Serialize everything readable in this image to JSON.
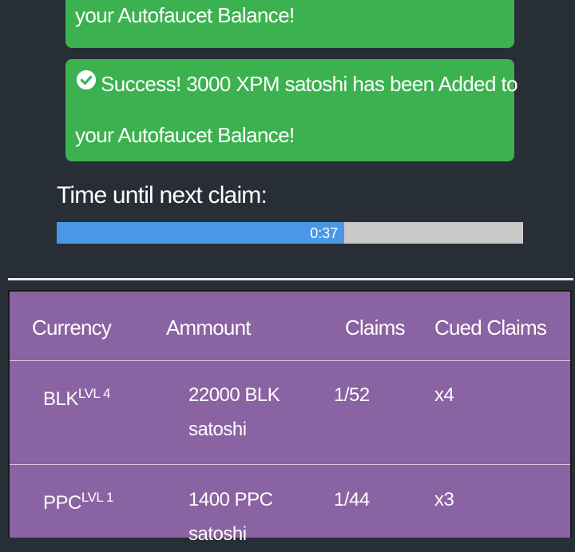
{
  "alerts": {
    "top_partial_text": "your Autofaucet Balance!",
    "main": {
      "line1": "Success! 3000 XPM satoshi has been Added to",
      "line2": "your Autofaucet Balance!"
    }
  },
  "timer": {
    "label": "Time until next claim:",
    "remaining_text": "0:37",
    "progress_fraction": 0.617
  },
  "table": {
    "headers": [
      "Currency",
      "Ammount",
      "Claims",
      "Cued Claims"
    ],
    "rows": [
      {
        "currency": "BLK",
        "level": "LVL 4",
        "amount_line1": "22000 BLK",
        "amount_line2": "satoshi",
        "claims": "1/52",
        "cued": "x4"
      },
      {
        "currency": "PPC",
        "level": "LVL 1",
        "amount_line1": "1400 PPC",
        "amount_line2": "satoshi",
        "claims": "1/44",
        "cued": "x3"
      }
    ]
  },
  "colors": {
    "background": "#272e36",
    "success_green": "#3bb24f",
    "progress_blue": "#4a97e6",
    "progress_track": "#c8c8c8",
    "table_purple": "#8a63a2"
  },
  "icons": [
    "check-circle-icon"
  ]
}
